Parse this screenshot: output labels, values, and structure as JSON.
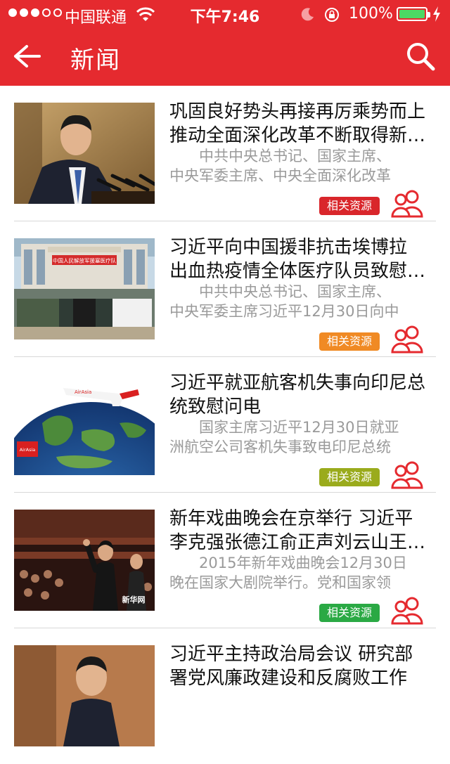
{
  "status_bar": {
    "carrier": "中国联通",
    "time": "下午7:46",
    "battery": "100%"
  },
  "nav": {
    "title": "新闻"
  },
  "colors": {
    "brand": "#e52a2f",
    "tag_red": "#d9262b",
    "tag_orange": "#f08a24",
    "tag_olive": "#9aab1c",
    "tag_green": "#2aa944"
  },
  "news": [
    {
      "title_line1": "巩固良好势头再接再厉乘势而上",
      "title_line2": "推动全面深化改革不断取得新…",
      "summary_line1": "　　中共中央总书记、国家主席、",
      "summary_line2": "中央军委主席、中央全面深化改革",
      "tag": "相关资源"
    },
    {
      "title_line1": "习近平向中国援非抗击埃博拉",
      "title_line2": "出血热疫情全体医疗队员致慰…",
      "summary_line1": "　　中共中央总书记、国家主席、",
      "summary_line2": "中央军委主席习近平12月30日向中",
      "tag": "相关资源"
    },
    {
      "title_line1": "习近平就亚航客机失事向印尼总",
      "title_line2": "统致慰问电",
      "summary_line1": "　　国家主席习近平12月30日就亚",
      "summary_line2": "洲航空公司客机失事致电印尼总统",
      "tag": "相关资源"
    },
    {
      "title_line1": "新年戏曲晚会在京举行 习近平",
      "title_line2": "李克强张德江俞正声刘云山王…",
      "summary_line1": "　　2015年新年戏曲晚会12月30日",
      "summary_line2": "晚在国家大剧院举行。党和国家领",
      "tag": "相关资源"
    },
    {
      "title_line1": "习近平主持政治局会议 研究部",
      "title_line2": "署党风廉政建设和反腐败工作"
    }
  ],
  "images": {
    "banner_text": "中国人民解放军援塞医疗队",
    "airline_logo": "AirAsia",
    "watermark": "新华网"
  }
}
